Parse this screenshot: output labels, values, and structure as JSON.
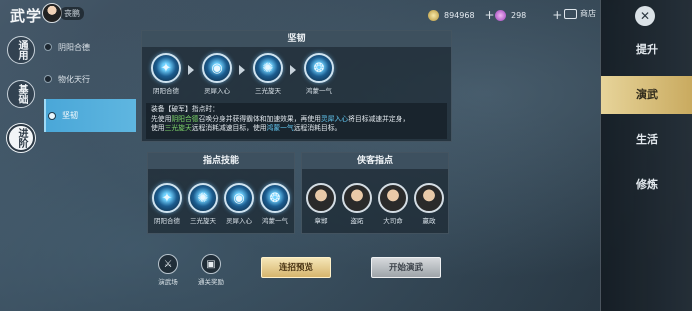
{
  "topbar": {
    "title": "武学",
    "avatar_name": "丧鹏",
    "coins": "894968",
    "gems": "298",
    "shop_label": "商店"
  },
  "left_tabs": [
    {
      "label": "通用"
    },
    {
      "label": "基础"
    },
    {
      "label": "进阶"
    }
  ],
  "sub_items": [
    {
      "label": "阴阳合德"
    },
    {
      "label": "物化天行"
    },
    {
      "label": "坚韧"
    }
  ],
  "panel": {
    "title": "坚韧",
    "sequence": [
      "阴阳合德",
      "灵犀入心",
      "三光旋天",
      "鸿蒙一气"
    ],
    "desc_line1": "装备【破军】指点时：",
    "desc_line2_a": "先使用",
    "desc_line2_b": "阴阳合德",
    "desc_line2_c": "召唤分身并获得霸体和加速效果，再使用",
    "desc_line2_d": "灵犀入心",
    "desc_line2_e": "将目标减速并定身，",
    "desc_line3_a": "使用",
    "desc_line3_b": "三光旋天",
    "desc_line3_c": "远程消耗减速目标，使用",
    "desc_line3_d": "鸿蒙一气",
    "desc_line3_e": "远程消耗目标。"
  },
  "skills_panel": {
    "title": "指点技能",
    "skills": [
      "阴阳合德",
      "三光旋天",
      "灵犀入心",
      "鸿蒙一气"
    ]
  },
  "heroes_panel": {
    "title": "侠客指点",
    "heroes": [
      "章邯",
      "盗跖",
      "大司命",
      "嬴政"
    ]
  },
  "bottom": {
    "arena_label": "演武场",
    "reward_label": "通关奖励",
    "preview_label": "连招预览",
    "start_label": "开始演武"
  },
  "right_tabs": [
    {
      "label": "提升"
    },
    {
      "label": "演武"
    },
    {
      "label": "生活"
    },
    {
      "label": "修炼"
    }
  ],
  "colors": {
    "accent_gold": "#d6b56d",
    "highlight_green": "#7fd96a",
    "highlight_blue": "#63c8f2",
    "active_blue": "#4aa7d8"
  }
}
